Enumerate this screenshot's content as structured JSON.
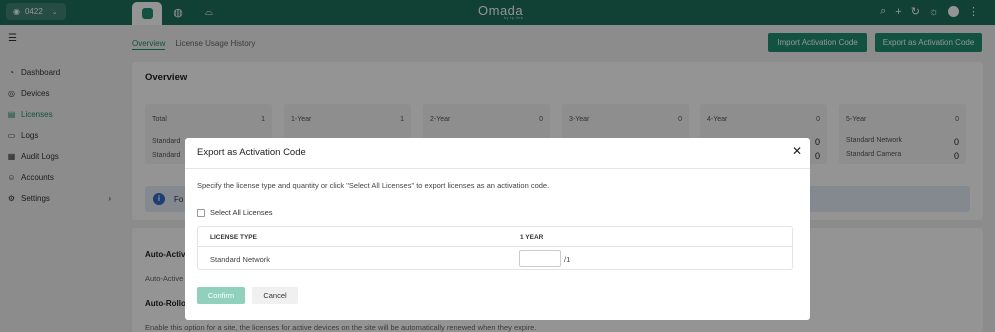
{
  "topbar": {
    "site_name": "0422",
    "logo_text": "Omada",
    "logo_sub": "by tp-link",
    "nav_tabs": [
      {
        "icon": "shield-icon"
      },
      {
        "icon": "globe-icon"
      },
      {
        "icon": "router-icon"
      }
    ],
    "icons": [
      "search-icon",
      "plus-icon",
      "refresh-icon",
      "theme-icon",
      "avatar",
      "more-icon"
    ],
    "accent_color": "#1e6f5c"
  },
  "sidebar": {
    "items": [
      {
        "label": "Dashboard",
        "icon": "dashboard-icon"
      },
      {
        "label": "Devices",
        "icon": "devices-icon"
      },
      {
        "label": "Licenses",
        "icon": "licenses-icon",
        "active": true
      },
      {
        "label": "Logs",
        "icon": "logs-icon"
      },
      {
        "label": "Audit Logs",
        "icon": "audit-logs-icon"
      },
      {
        "label": "Accounts",
        "icon": "accounts-icon"
      },
      {
        "label": "Settings",
        "icon": "settings-icon"
      }
    ]
  },
  "subtabs": {
    "overview": "Overview",
    "history": "License Usage History"
  },
  "actions": {
    "import_label": "Import Activation Code",
    "export_label": "Export as Activation Code",
    "button_color": "#1e8f6e"
  },
  "overview": {
    "title": "Overview",
    "cards": [
      {
        "label": "Total",
        "value": "1",
        "rows": [
          {
            "label": "Standard",
            "value": ""
          },
          {
            "label": "Standard",
            "value": ""
          }
        ]
      },
      {
        "label": "1-Year",
        "value": "1",
        "rows": []
      },
      {
        "label": "2-Year",
        "value": "0",
        "rows": []
      },
      {
        "label": "3-Year",
        "value": "0",
        "rows": []
      },
      {
        "label": "4-Year",
        "value": "0",
        "rows": [
          {
            "label": "",
            "value": "0"
          },
          {
            "label": "",
            "value": "0"
          }
        ]
      },
      {
        "label": "5-Year",
        "value": "0",
        "rows": [
          {
            "label": "Standard Network",
            "value": "0"
          },
          {
            "label": "Standard Camera",
            "value": "0"
          }
        ]
      }
    ],
    "info_text": "Fo"
  },
  "lower": {
    "auto_active_label": "Auto-Active",
    "auto_active_text": "Auto-Active",
    "auto_rollover_label": "Auto-Rollo",
    "rollover_desc": "Enable this option for a site, the licenses for active devices on the site will be automatically renewed when they expire."
  },
  "modal": {
    "title": "Export as Activation Code",
    "description": "Specify the license type and quantity or click \"Select All Licenses\" to export licenses as an activation code.",
    "select_all_label": "Select All Licenses",
    "table": {
      "headers": [
        "LICENSE TYPE",
        "1 YEAR"
      ],
      "rows": [
        {
          "type": "Standard Network",
          "quantity": "",
          "max": "/1"
        }
      ]
    },
    "confirm_label": "Confirm",
    "cancel_label": "Cancel"
  }
}
